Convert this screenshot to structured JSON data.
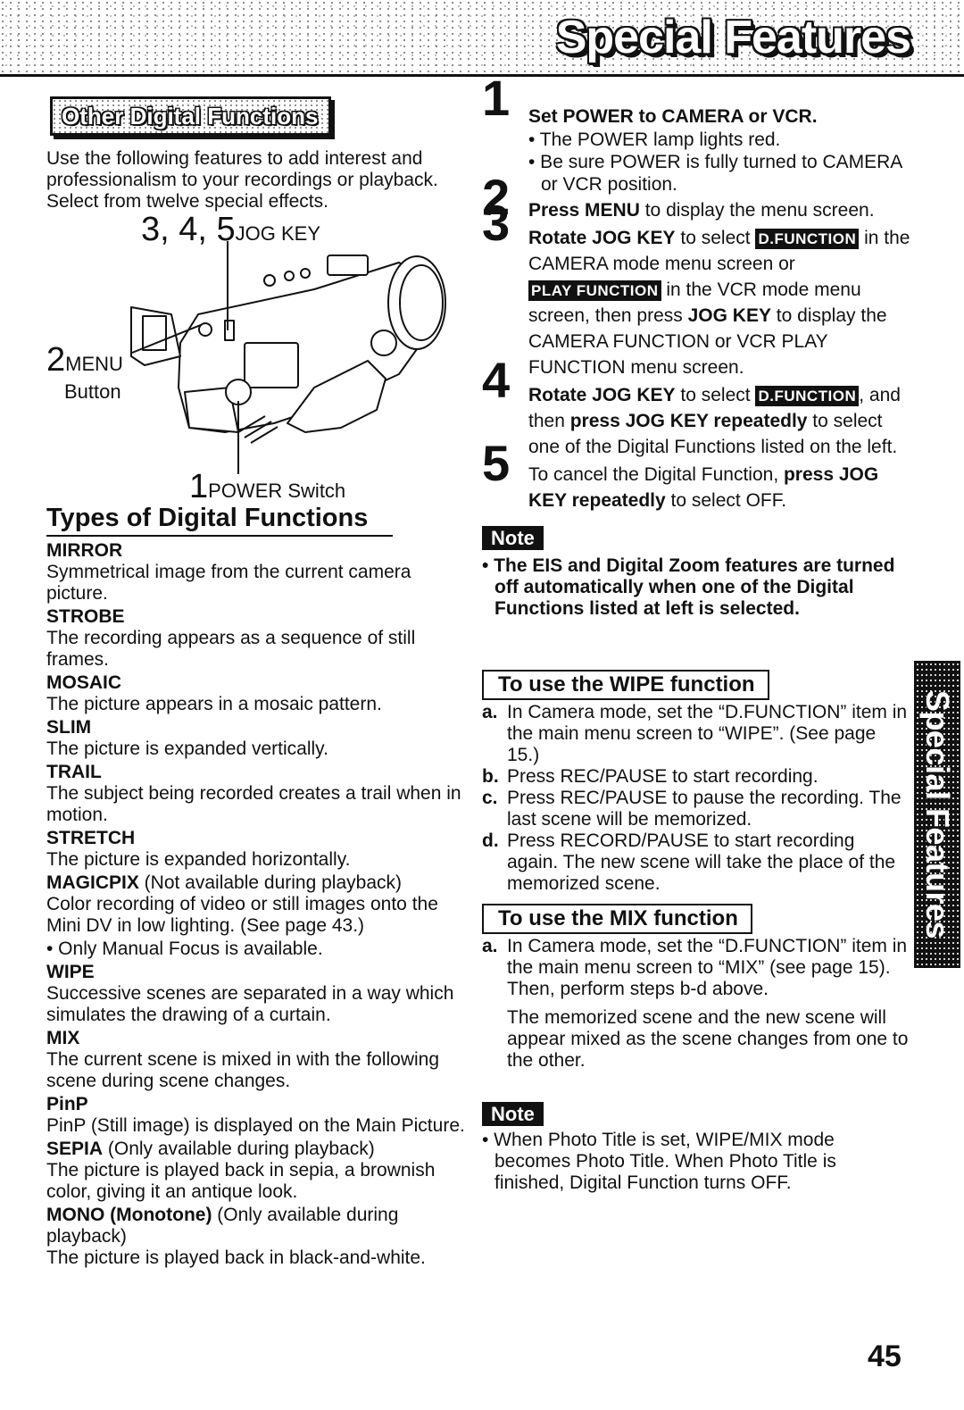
{
  "header": {
    "title": "Special Features"
  },
  "left": {
    "section_title": "Other Digital Functions",
    "intro": "Use the following features to add interest and professionalism to your recordings or playback. Select from twelve special effects.",
    "figure": {
      "jog_num": "3, 4, 5",
      "jog_label": "JOG KEY",
      "menu_num": "2",
      "menu_label": "MENU",
      "menu_label2": "Button",
      "power_num": "1",
      "power_label": "POWER Switch"
    },
    "types_title": "Types of Digital Functions",
    "functions": [
      {
        "name": "MIRROR",
        "qualifier": "",
        "desc": "Symmetrical image from the current camera picture."
      },
      {
        "name": "STROBE",
        "qualifier": "",
        "desc": "The recording appears as a sequence of still frames."
      },
      {
        "name": "MOSAIC",
        "qualifier": "",
        "desc": "The picture appears in a mosaic pattern."
      },
      {
        "name": "SLIM",
        "qualifier": "",
        "desc": "The picture is expanded vertically."
      },
      {
        "name": "TRAIL",
        "qualifier": "",
        "desc": "The subject being recorded creates a trail when in motion."
      },
      {
        "name": "STRETCH",
        "qualifier": "",
        "desc": "The picture is expanded horizontally."
      },
      {
        "name": "MAGICPIX",
        "qualifier": " (Not available during playback)",
        "desc": "Color recording of video or still images onto the Mini DV in low lighting. (See page 43.)",
        "bullet": "• Only Manual Focus is available."
      },
      {
        "name": "WIPE",
        "qualifier": "",
        "desc": "Successive scenes are separated in a way which simulates the drawing of a curtain."
      },
      {
        "name": "MIX",
        "qualifier": "",
        "desc": "The current scene is mixed in with the following scene during scene changes."
      },
      {
        "name": "PinP",
        "qualifier": "",
        "desc": "PinP (Still image) is displayed on the Main Picture."
      },
      {
        "name": "SEPIA",
        "qualifier": " (Only available during playback)",
        "desc": "The picture is played back in sepia, a brownish color, giving it an antique look."
      },
      {
        "name": "MONO (Monotone)",
        "qualifier": " (Only available during playback)",
        "desc": "The picture is played back in black-and-white."
      }
    ]
  },
  "right": {
    "steps": {
      "s1_num": "1",
      "s1_title": "Set POWER to CAMERA or VCR.",
      "s1_b1": "• The POWER lamp lights red.",
      "s1_b2": "• Be sure POWER is fully turned to CAMERA or VCR position.",
      "s2_num": "2",
      "s2_bold": "Press MENU",
      "s2_rest": " to display the menu screen.",
      "s3_num": "3",
      "s3_bold1": "Rotate JOG KEY",
      "s3_t1": " to select ",
      "s3_chip1": "D.FUNCTION",
      "s3_t2": " in the CAMERA mode menu screen or ",
      "s3_chip2": "PLAY FUNCTION",
      "s3_t3": " in the VCR mode menu screen, then press ",
      "s3_bold2": "JOG KEY",
      "s3_t4": " to display the CAMERA FUNCTION or VCR PLAY FUNCTION menu screen.",
      "s4_num": "4",
      "s4_bold1": "Rotate JOG KEY",
      "s4_t1": " to select ",
      "s4_chip": "D.FUNCTION",
      "s4_t2": ", and then ",
      "s4_bold2": "press JOG KEY repeatedly",
      "s4_t3": " to select one of the Digital Functions listed on the left.",
      "s5_num": "5",
      "s5_t1": "To cancel the Digital Function, ",
      "s5_bold": "press JOG KEY repeatedly",
      "s5_t2": " to select OFF."
    },
    "note1": {
      "label": "Note",
      "text": "• The EIS and Digital Zoom features are turned off automatically when one of the Digital Functions listed at left is selected."
    },
    "wipe": {
      "title": "To use the WIPE function",
      "items": [
        {
          "letter": "a.",
          "text": "In Camera mode, set the “D.FUNCTION” item in the main menu screen to “WIPE”. (See page 15.)"
        },
        {
          "letter": "b.",
          "text": "Press REC/PAUSE to start recording."
        },
        {
          "letter": "c.",
          "text": "Press REC/PAUSE to pause the recording. The last scene will be memorized."
        },
        {
          "letter": "d.",
          "text": "Press RECORD/PAUSE to start recording again. The new scene will take the place of the memorized scene."
        }
      ]
    },
    "mix": {
      "title": "To use the MIX function",
      "items": [
        {
          "letter": "a.",
          "text": "In Camera mode, set the “D.FUNCTION” item in the main menu screen to “MIX” (see page 15). Then, perform steps b-d above."
        }
      ],
      "para": "The memorized scene and the new scene will appear mixed as the scene changes from one to the other."
    },
    "note2": {
      "label": "Note",
      "text": "• When Photo Title is set, WIPE/MIX mode becomes Photo Title. When Photo Title is finished, Digital Function turns OFF."
    }
  },
  "side_tab": {
    "text": "Special Features"
  },
  "page_number": "45"
}
